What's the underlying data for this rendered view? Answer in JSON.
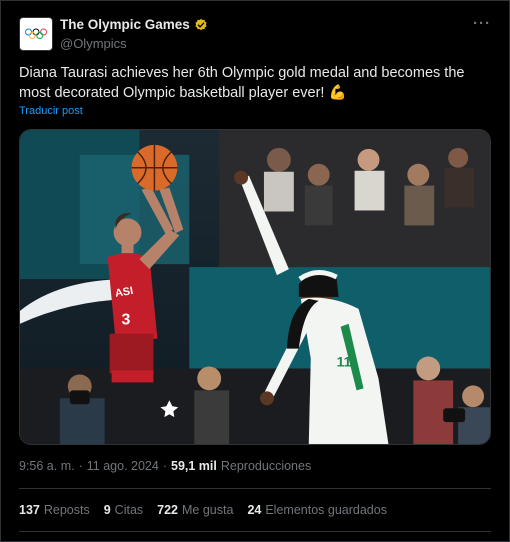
{
  "account": {
    "display_name": "The Olympic Games",
    "handle": "@Olympics",
    "verified_color": "#e2b719"
  },
  "tweet": {
    "text": "Diana Taurasi achieves her 6th Olympic gold medal and becomes the most decorated Olympic basketball player ever! 💪",
    "translate_label": "Traducir post"
  },
  "media": {
    "jersey_left_text": "ASI",
    "jersey_left_number": "3",
    "jersey_right_number": "11"
  },
  "meta": {
    "time": "9:56 a. m.",
    "separator": "·",
    "date": "11 ago. 2024",
    "views_count": "59,1 mil",
    "views_label": "Reproducciones"
  },
  "stats": [
    {
      "count": "137",
      "label": "Reposts"
    },
    {
      "count": "9",
      "label": "Citas"
    },
    {
      "count": "722",
      "label": "Me gusta"
    },
    {
      "count": "24",
      "label": "Elementos guardados"
    }
  ],
  "colors": {
    "background": "#000000",
    "text_primary": "#e7e9ea",
    "text_secondary": "#71767b",
    "link": "#1d9bf0",
    "divider": "#2f3336"
  }
}
